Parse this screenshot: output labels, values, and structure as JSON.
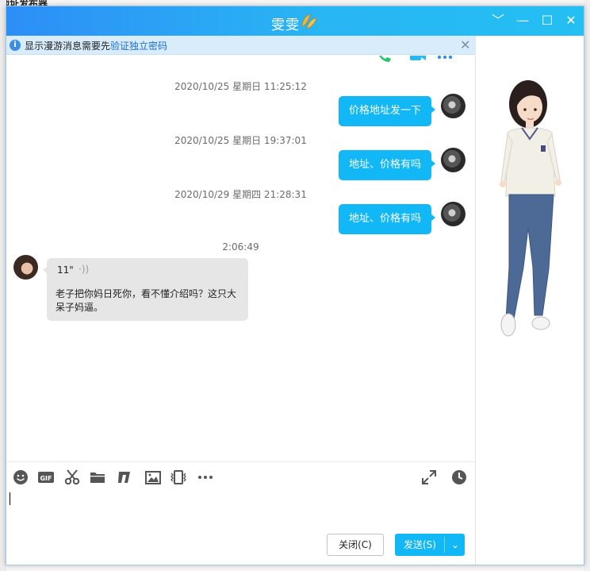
{
  "background_app": {
    "title_fragment": "地址发布器"
  },
  "window": {
    "title": "雯雯",
    "controls": {
      "dropdown": "﹀",
      "minimize": "—",
      "maximize": "☐",
      "close": "✕"
    }
  },
  "notice": {
    "text_prefix": "显示漫游消息需要先",
    "link_text": "验证独立密码",
    "close": "✕"
  },
  "messages": [
    {
      "timestamp": "2020/10/25 星期日 11:25:12",
      "direction": "out",
      "text": "价格地址发一下"
    },
    {
      "timestamp": "2020/10/25 星期日 19:37:01",
      "direction": "out",
      "text": "地址、价格有吗"
    },
    {
      "timestamp": "2020/10/29 星期四 21:28:31",
      "direction": "out",
      "text": "地址、价格有吗"
    },
    {
      "timestamp": "2:06:49",
      "direction": "in",
      "voice_duration": "11\"",
      "text": "老子把你妈日死你，看不懂介绍吗？这只大呆子妈逼。"
    }
  ],
  "toolbar": {
    "icons": [
      "emoji-icon",
      "gif-icon",
      "screenshot-scissors-icon",
      "folder-icon",
      "music-icon",
      "image-icon",
      "shake-window-icon",
      "more-icon",
      "expand-icon",
      "history-clock-icon"
    ]
  },
  "buttons": {
    "close_label": "关闭(C)",
    "send_label": "发送(S)",
    "send_dropdown": "⌄"
  },
  "colors": {
    "titlebar_start": "#2d8ef6",
    "titlebar_end": "#24bff3",
    "bubble_out": "#12b7f5",
    "bubble_in": "#e6e6e6",
    "link": "#1a6fd0"
  }
}
